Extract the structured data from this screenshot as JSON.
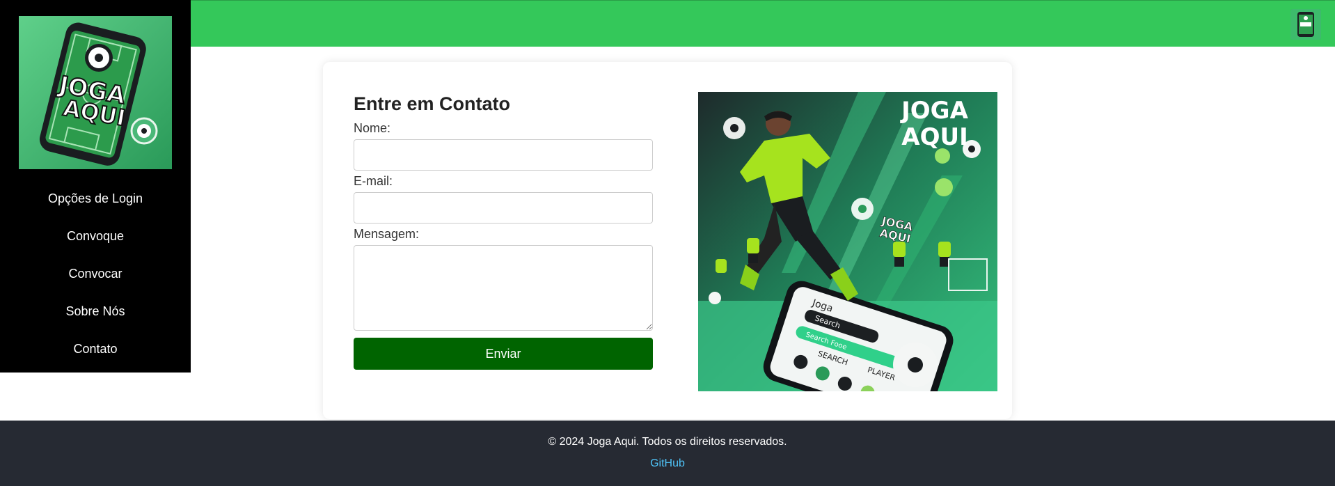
{
  "colors": {
    "topbar": "#34c85a",
    "sidebar": "#000000",
    "submit_button": "#006400",
    "footer": "#262a33",
    "link": "#4fc3f7"
  },
  "brand": {
    "logo_text_line1": "JOGA",
    "logo_text_line2": "AQUI"
  },
  "sidebar": {
    "items": [
      {
        "label": "Opções de Login"
      },
      {
        "label": "Convoque"
      },
      {
        "label": "Convocar"
      },
      {
        "label": "Sobre Nós"
      },
      {
        "label": "Contato"
      }
    ]
  },
  "contact_form": {
    "title": "Entre em Contato",
    "name_label": "Nome:",
    "name_value": "",
    "email_label": "E-mail:",
    "email_value": "",
    "message_label": "Mensagem:",
    "message_value": "",
    "submit_label": "Enviar"
  },
  "hero": {
    "title_line1": "JOGA",
    "title_line2": "AQUI",
    "sub_logo_line1": "JOGA",
    "sub_logo_line2": "AQUI",
    "phone_app_name": "Joga",
    "phone_search": "Search",
    "phone_search_button": "Search Fooe",
    "phone_col1": "SEARCH",
    "phone_col2": "PLAYER"
  },
  "footer": {
    "copyright": "© 2024 Joga Aqui. Todos os direitos reservados.",
    "link_label": "GitHub"
  }
}
